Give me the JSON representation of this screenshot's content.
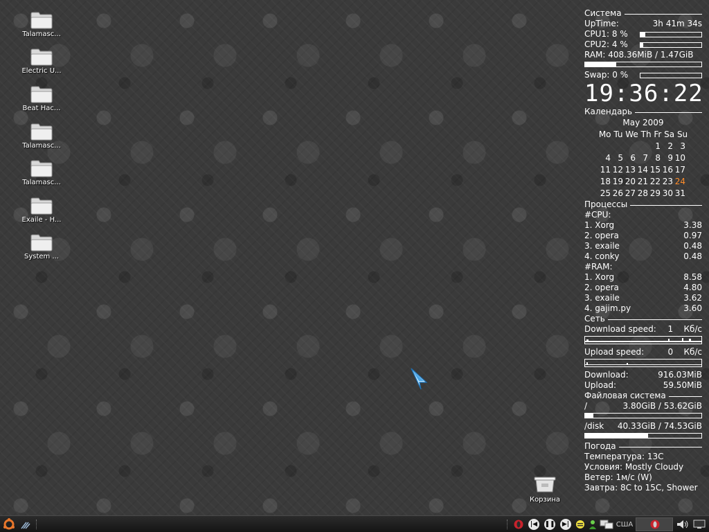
{
  "desktop_icons": [
    {
      "label": "Talamasc...",
      "icon": "folder-icon"
    },
    {
      "label": "Electric U...",
      "icon": "folder-icon"
    },
    {
      "label": "Beat Hac...",
      "icon": "folder-icon"
    },
    {
      "label": "Talamasc...",
      "icon": "folder-icon"
    },
    {
      "label": "Talamasc...",
      "icon": "folder-icon"
    },
    {
      "label": "Exaile - H...",
      "icon": "folder-icon"
    },
    {
      "label": "System ...",
      "icon": "folder-icon"
    }
  ],
  "trash": {
    "label": "Корзина",
    "icon": "trash-icon"
  },
  "conky": {
    "system": {
      "title": "Система",
      "uptime_label": "UpTime:",
      "uptime_value": "3h 41m 34s",
      "cpu1_label": "CPU1: 8  %",
      "cpu1_fraction": 0.08,
      "cpu2_label": "CPU2: 4  %",
      "cpu2_fraction": 0.04,
      "ram_label": "RAM:  408.36MiB / 1.47GiB",
      "ram_fraction": 0.27,
      "swap_label": "Swap: 0  %",
      "swap_fraction": 0.0
    },
    "clock": "19:36:22",
    "calendar": {
      "title": "Календарь",
      "month_year": "May  2009",
      "weekdays": "Mo Tu We Th Fr Sa Su",
      "days": [
        "",
        "",
        "",
        "",
        "1",
        "2",
        "3",
        "4",
        "5",
        "6",
        "7",
        "8",
        "9",
        "10",
        "11",
        "12",
        "13",
        "14",
        "15",
        "16",
        "17",
        "18",
        "19",
        "20",
        "21",
        "22",
        "23",
        "24",
        "25",
        "26",
        "27",
        "28",
        "29",
        "30",
        "31"
      ],
      "today": "24",
      "today_color": "#ff8c2a"
    },
    "processes": {
      "title": "Процессы",
      "cpu_label": "#CPU:",
      "cpu": [
        {
          "name": "1. Xorg",
          "value": "3.38"
        },
        {
          "name": "2. opera",
          "value": "0.97"
        },
        {
          "name": "3. exaile",
          "value": "0.48"
        },
        {
          "name": "4. conky",
          "value": "0.48"
        }
      ],
      "ram_label": "#RAM:",
      "ram": [
        {
          "name": "1. Xorg",
          "value": "8.58"
        },
        {
          "name": "2. opera",
          "value": "4.80"
        },
        {
          "name": "3. exaile",
          "value": "3.62"
        },
        {
          "name": "4. gajim.py",
          "value": "3.60"
        }
      ]
    },
    "network": {
      "title": "Сеть",
      "download_speed_label": "Download speed:",
      "download_speed_value": "1",
      "download_speed_unit": "Кб/с",
      "upload_speed_label": "Upload speed:",
      "upload_speed_value": "0",
      "upload_speed_unit": "Кб/с",
      "download_total_label": "Download:",
      "download_total_value": "916.03MiB",
      "upload_total_label": "Upload:",
      "upload_total_value": "59.50MiB"
    },
    "filesystem": {
      "title": "Файловая система",
      "root_label": "/",
      "root_value": "3.80GiB  / 53.62GiB",
      "root_fraction": 0.07,
      "disk_label": "/disk",
      "disk_value": "40.33GiB / 74.53GiB",
      "disk_fraction": 0.54
    },
    "weather": {
      "title": "Погода",
      "temperature": "Температура: 13C",
      "conditions": "Условия: Mostly Cloudy",
      "wind": "Ветер:  1м/с (W)",
      "tomorrow": "Завтра: 8C to 15C, Shower"
    }
  },
  "taskbar": {
    "keyboard_layout": "США",
    "menu_icon": "ubuntu-logo-icon",
    "tray_icons": [
      "opera-icon",
      "prev-track-icon",
      "pause-icon",
      "next-track-icon",
      "gajim-icon",
      "chat-icon",
      "network-icon",
      "volume-icon",
      "display-icon"
    ]
  }
}
